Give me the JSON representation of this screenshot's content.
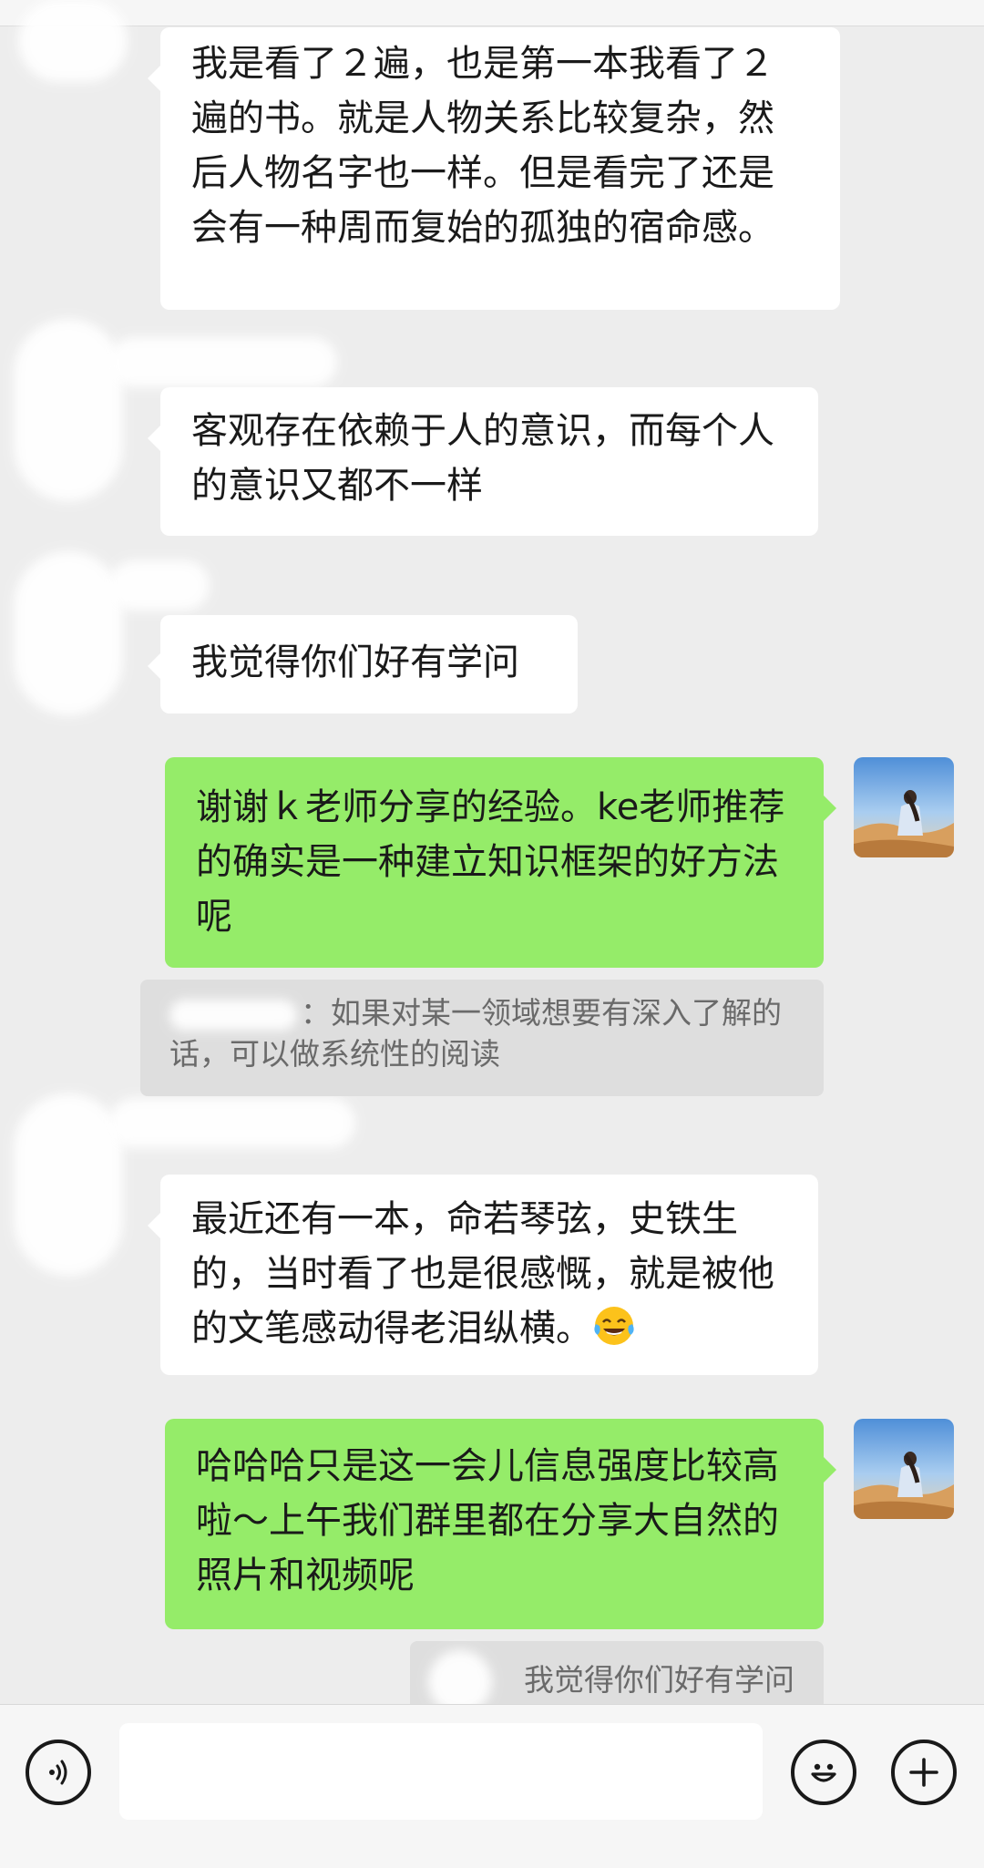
{
  "messages": [
    {
      "side": "in",
      "text": "我是看了２遍，也是第一本我看了２遍的书。就是人物关系比较复杂，然后人物名字也一样。但是看完了还是会有一种周而复始的孤独的宿命感。"
    },
    {
      "side": "in",
      "text": "客观存在依赖于人的意识，而每个人的意识又都不一样"
    },
    {
      "side": "in",
      "text": "我觉得你们好有学问"
    },
    {
      "side": "out",
      "text": "谢谢ｋ老师分享的经验。ke老师推荐的确实是一种建立知识框架的好方法呢"
    },
    {
      "side": "quote",
      "text": "：如果对某一领域想要有深入了解的话，可以做系统性的阅读"
    },
    {
      "side": "in",
      "text": "最近还有一本，命若琴弦，史铁生的，当时看了也是很感慨，就是被他的文笔感动得老泪纵横。",
      "emoji": "tears-of-joy-emoji"
    },
    {
      "side": "out",
      "text": "哈哈哈只是这一会儿信息强度比较高啦～上午我们群里都在分享大自然的照片和视频呢"
    },
    {
      "side": "quote",
      "text": "我觉得你们好有学问"
    }
  ],
  "input_bar": {
    "left_icon": "voice-icon",
    "right_icons": [
      "emoji-icon",
      "plus-icon"
    ],
    "placeholder": ""
  },
  "colors": {
    "background": "#ededed",
    "incoming_bubble": "#ffffff",
    "outgoing_bubble": "#95ec69",
    "quote_bg": "#dedede"
  }
}
